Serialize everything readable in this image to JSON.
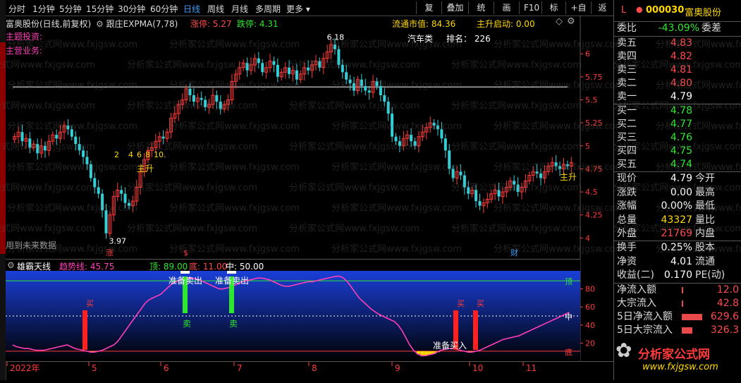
{
  "toolbar": {
    "periods": [
      "分时",
      "1分钟",
      "5分钟",
      "15分钟",
      "30分钟",
      "60分钟",
      "日线",
      "周线",
      "月线",
      "多周期",
      "更多"
    ],
    "active_period": "日线",
    "buttons": [
      "复权",
      "叠加",
      "统计",
      "画线",
      "F10",
      "标记",
      "+自选",
      "返回"
    ]
  },
  "main_header": {
    "stock_title": "富奥股份(日线,前复权)",
    "indicator": "跟庄EXPMA(7,78)",
    "limit_up": "涨停: 5.27",
    "limit_down": "跌停: 4.31",
    "float_cap": "流通市值: 84.36",
    "main_rise": "主升启动: 0.00",
    "sector": "汽车类",
    "rank": "排名： 226",
    "topic_label": "主题投资:",
    "business_label": "主营业务:",
    "future_note": "用到未来数据"
  },
  "chart_data": [
    {
      "type": "candlestick",
      "title": "富奥股份(日线,前复权)",
      "y_ticks": [
        6.0,
        5.75,
        5.5,
        5.25,
        5.0,
        4.75,
        4.5,
        4.25,
        4.0
      ],
      "ylim": [
        3.88,
        6.27
      ],
      "hline": 5.64,
      "annotations": [
        {
          "text": "6.18",
          "x": "high",
          "y": 6.18
        },
        {
          "text": "3.97",
          "x": "low",
          "y": 3.97
        },
        {
          "text": "2",
          "kind": "count"
        },
        {
          "text": "4",
          "kind": "count"
        },
        {
          "text": "6",
          "kind": "count"
        },
        {
          "text": "8",
          "kind": "count"
        },
        {
          "text": "10.",
          "kind": "count"
        },
        {
          "text": "主升",
          "kind": "signal"
        },
        {
          "text": "主升",
          "kind": "signal"
        }
      ],
      "markers": [
        "涨",
        "$",
        "财"
      ],
      "closes": [
        5.1,
        5.15,
        5.05,
        5.08,
        4.98,
        5.02,
        4.92,
        5.0,
        4.95,
        5.05,
        5.12,
        5.08,
        5.15,
        5.22,
        5.18,
        5.1,
        5.02,
        4.95,
        4.88,
        4.8,
        4.65,
        4.55,
        4.48,
        4.3,
        4.05,
        4.25,
        4.45,
        4.52,
        4.48,
        4.38,
        4.35,
        4.4,
        4.55,
        4.72,
        4.85,
        4.95,
        4.98,
        5.05,
        5.1,
        5.08,
        5.15,
        5.3,
        5.35,
        5.45,
        5.5,
        5.62,
        5.55,
        5.48,
        5.52,
        5.5,
        5.42,
        5.45,
        5.55,
        5.48,
        5.4,
        5.45,
        5.5,
        5.7,
        5.78,
        5.85,
        5.9,
        5.82,
        5.88,
        5.95,
        5.9,
        5.8,
        5.85,
        5.92,
        5.88,
        5.75,
        5.8,
        5.85,
        5.78,
        5.82,
        5.72,
        5.78,
        5.85,
        5.82,
        5.88,
        5.92,
        5.85,
        5.95,
        6.02,
        6.1,
        6.05,
        5.88,
        5.8,
        5.72,
        5.68,
        5.6,
        5.72,
        5.65,
        5.6,
        5.58,
        5.7,
        5.65,
        5.55,
        5.48,
        5.35,
        5.1,
        5.05,
        5.0,
        5.08,
        5.12,
        5.05,
        5.0,
        5.1,
        5.15,
        5.2,
        5.25,
        5.22,
        5.18,
        5.08,
        4.95,
        4.75,
        4.65,
        4.72,
        4.68,
        4.55,
        4.48,
        4.52,
        4.4,
        4.35,
        4.38,
        4.42,
        4.48,
        4.52,
        4.45,
        4.5,
        4.55,
        4.62,
        4.58,
        4.5,
        4.55,
        4.62,
        4.68,
        4.72,
        4.7,
        4.65,
        4.72,
        4.78,
        4.82,
        4.78,
        4.75,
        4.8,
        4.78,
        4.82
      ],
      "sub": {
        "name": "雄霸天线",
        "trend_label": "趋势线: 45.75",
        "top_label": "顶: 89.00",
        "bottom_label": "底: 11.00",
        "mid_label": "中: 50.00",
        "y_ticks": [
          80.0,
          60.0,
          40.0,
          20.0
        ],
        "ylim": [
          0,
          100
        ],
        "top": 89,
        "mid": 50,
        "bottom": 11,
        "signals": [
          {
            "text": "准备卖出",
            "kind": "sell"
          },
          {
            "text": "准备卖出",
            "kind": "sell"
          },
          {
            "text": "准备买入",
            "kind": "buy"
          },
          {
            "text": "卖",
            "kind": "sell-arrow"
          },
          {
            "text": "卖",
            "kind": "sell-arrow"
          },
          {
            "text": "买",
            "kind": "buy-star"
          },
          {
            "text": "买",
            "kind": "buy-star"
          },
          {
            "text": "买",
            "kind": "buy-star"
          }
        ],
        "side_labels": [
          "顶",
          "中",
          "底"
        ],
        "trend": [
          18,
          16,
          15,
          14,
          14,
          13,
          12,
          12,
          12,
          13,
          14,
          15,
          16,
          17,
          18,
          16,
          14,
          13,
          12,
          11,
          10,
          10,
          11,
          12,
          14,
          16,
          18,
          22,
          28,
          34,
          40,
          46,
          52,
          58,
          64,
          68,
          70,
          72,
          74,
          78,
          82,
          86,
          88,
          90,
          91,
          92,
          92,
          91,
          90,
          88,
          86,
          84,
          82,
          80,
          80,
          81,
          82,
          84,
          86,
          88,
          89,
          90,
          91,
          92,
          92,
          91,
          90,
          88,
          86,
          84,
          83,
          83,
          84,
          85,
          86,
          87,
          88,
          88,
          89,
          90,
          91,
          92,
          93,
          94,
          94,
          92,
          88,
          82,
          76,
          70,
          66,
          62,
          58,
          55,
          52,
          50,
          48,
          46,
          44,
          40,
          34,
          26,
          18,
          12,
          8,
          6,
          6,
          7,
          8,
          10,
          12,
          13,
          14,
          14,
          13,
          12,
          11,
          10,
          10,
          11,
          12,
          14,
          16,
          18,
          20,
          22,
          24,
          25,
          26,
          27,
          28,
          30,
          32,
          34,
          36,
          38,
          40,
          42,
          44,
          46,
          48,
          50,
          52,
          54
        ]
      },
      "x_labels": [
        "2022年",
        "5",
        "6",
        "7",
        "8",
        "9",
        "10",
        "11"
      ]
    }
  ],
  "right_panel": {
    "flag": "L",
    "code": "000030",
    "name": "富奥股份",
    "weibi_label": "委比",
    "weibi_value": "-43.09%",
    "weicha_label": "委差",
    "asks": [
      {
        "label": "卖五",
        "price": "4.83"
      },
      {
        "label": "卖四",
        "price": "4.82"
      },
      {
        "label": "卖三",
        "price": "4.81"
      },
      {
        "label": "卖二",
        "price": "4.80"
      },
      {
        "label": "卖一",
        "price": "4.79"
      }
    ],
    "bids": [
      {
        "label": "买一",
        "price": "4.78"
      },
      {
        "label": "买二",
        "price": "4.77"
      },
      {
        "label": "买三",
        "price": "4.76"
      },
      {
        "label": "买四",
        "price": "4.75"
      },
      {
        "label": "买五",
        "price": "4.74"
      }
    ],
    "quote": [
      {
        "l": "现价",
        "v": "4.79",
        "l2": "今开"
      },
      {
        "l": "涨跌",
        "v": "0.00",
        "l2": "最高"
      },
      {
        "l": "涨幅",
        "v": "0.00%",
        "l2": "最低"
      },
      {
        "l": "总量",
        "v": "43327",
        "l2": "量比"
      },
      {
        "l": "外盘",
        "v": "21769",
        "l2": "内盘"
      }
    ],
    "stats": [
      {
        "l": "换手",
        "v": "0.25%",
        "l2": "股本"
      },
      {
        "l": "净资",
        "v": "4.01",
        "l2": "流通"
      },
      {
        "l": "收益(二)",
        "v": "0.170",
        "l2": "PE(动)"
      }
    ],
    "flows": [
      {
        "l": "净流入额",
        "v": "12.0",
        "pct": 2
      },
      {
        "l": "大宗流入",
        "v": "42.8",
        "pct": 4
      },
      {
        "l": "5日净流入额",
        "v": "629.6",
        "pct": 52
      },
      {
        "l": "5日大宗流入",
        "v": "326.3",
        "pct": 28
      }
    ],
    "logo_text": "分析家公式网",
    "logo_url": "www.fxjgsw.com"
  },
  "watermark": "分析家公式网www.fxjgsw.com",
  "colors": {
    "up": "#ff3a3a",
    "down": "#33d0d8",
    "bg": "#000000",
    "sub_bg_top": "#1a3fb0",
    "trend": "#ff3fb8",
    "buy": "#ffd700"
  }
}
